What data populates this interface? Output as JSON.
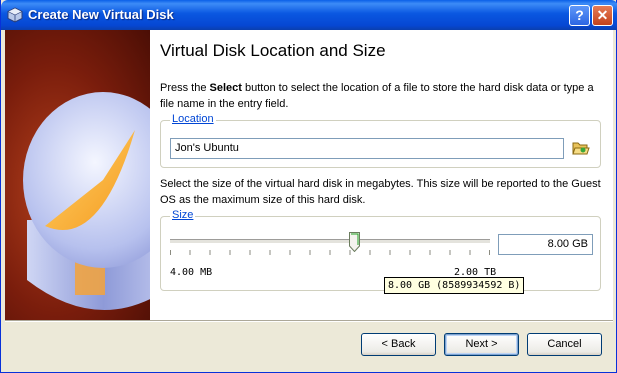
{
  "window": {
    "title": "Create New Virtual Disk",
    "help_glyph": "?",
    "close_glyph": "✕"
  },
  "page": {
    "title": "Virtual Disk Location and Size",
    "intro_prefix": "Press the ",
    "intro_bold": "Select",
    "intro_suffix": " button to select the location of a file to store the hard disk data or type a file name in the entry field."
  },
  "location": {
    "label": "Location",
    "value": "Jon's Ubuntu",
    "select_icon": "folder-open-icon"
  },
  "size": {
    "description": "Select the size of the virtual hard disk in megabytes. This size will be reported to the Guest OS as the maximum size of this hard disk.",
    "label": "Size",
    "value": "8.00 GB",
    "min_label": "4.00 MB",
    "max_label": "2.00 TB",
    "slider_fraction": 0.58,
    "tooltip": "8.00 GB (8589934592 B)"
  },
  "buttons": {
    "back_label": "< Back",
    "next_label": "Next >",
    "cancel_label": "Cancel"
  }
}
